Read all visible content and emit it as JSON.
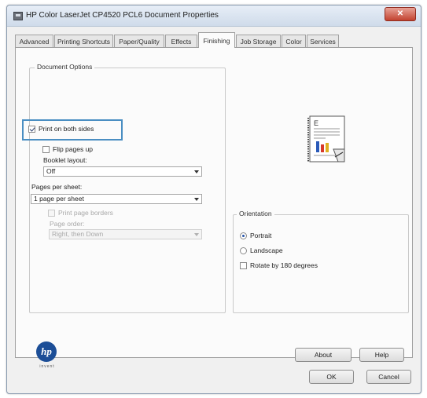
{
  "window": {
    "title": "HP Color LaserJet CP4520 PCL6 Document Properties",
    "close_label": "✕"
  },
  "tabs": [
    {
      "label": "Advanced",
      "active": false
    },
    {
      "label": "Printing Shortcuts",
      "active": false
    },
    {
      "label": "Paper/Quality",
      "active": false
    },
    {
      "label": "Effects",
      "active": false
    },
    {
      "label": "Finishing",
      "active": true
    },
    {
      "label": "Job Storage",
      "active": false
    },
    {
      "label": "Color",
      "active": false
    },
    {
      "label": "Services",
      "active": false
    }
  ],
  "document_options": {
    "legend": "Document Options",
    "print_both_sides": {
      "label": "Print on both sides",
      "checked": true
    },
    "flip_pages_up": {
      "label": "Flip pages up",
      "checked": false
    },
    "booklet_layout": {
      "label": "Booklet layout:",
      "value": "Off"
    },
    "pages_per_sheet": {
      "label": "Pages per sheet:",
      "value": "1 page per sheet"
    },
    "print_page_borders": {
      "label": "Print page borders",
      "checked": false,
      "disabled": true
    },
    "page_order": {
      "label": "Page order:",
      "value": "Right, then Down",
      "disabled": true
    }
  },
  "orientation": {
    "legend": "Orientation",
    "options": [
      {
        "label": "Portrait",
        "selected": true
      },
      {
        "label": "Landscape",
        "selected": false
      }
    ],
    "rotate_180": {
      "label": "Rotate by 180 degrees",
      "checked": false
    }
  },
  "buttons": {
    "about": "About",
    "help": "Help",
    "ok": "OK",
    "cancel": "Cancel"
  },
  "logo": {
    "text": "hp",
    "subtext": "invent"
  },
  "colors": {
    "focus_ring": "#4a8ec2",
    "hp_blue": "#1c4e97",
    "close_red": "#c2422f"
  }
}
